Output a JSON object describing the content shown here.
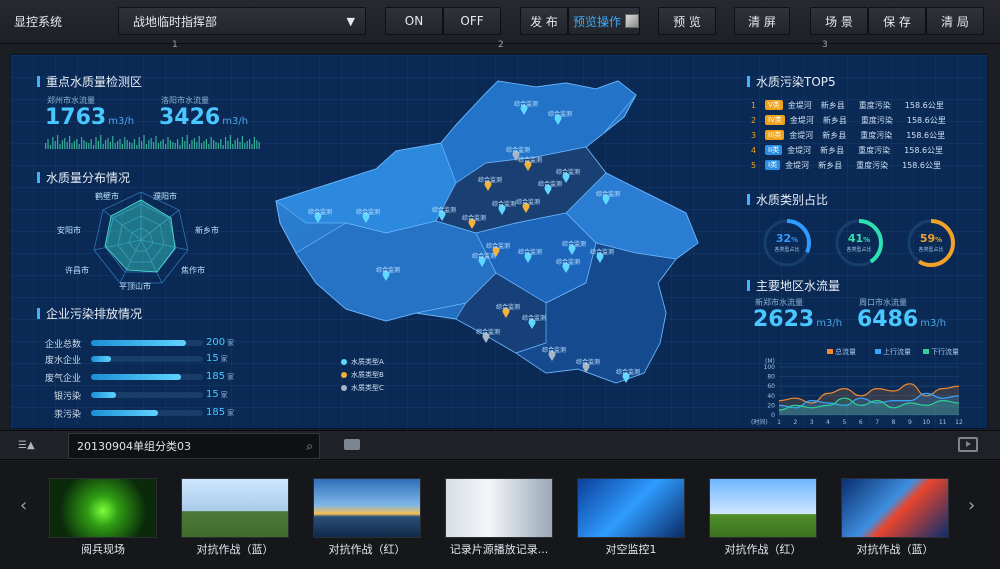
{
  "app": {
    "title": "显控系统"
  },
  "toolbar": {
    "command_select": "战地临时指挥部",
    "on_label": "ON",
    "off_label": "OFF",
    "publish_label": "发 布",
    "preview_op_label": "预览操作",
    "preview_label": "预 览",
    "clear_label": "清 屏",
    "scene_label": "场 景",
    "save_label": "保 存",
    "clear_layout_label": "清 局",
    "marker1": "1",
    "marker2": "2",
    "marker3": "3"
  },
  "left": {
    "monitor_title": "重点水质量检测区",
    "zhengzhou_label": "郑州市水流量",
    "zhengzhou_value": "1763",
    "luoyang_label": "洛阳市水流量",
    "luoyang_value": "3426",
    "flow_unit": "m3/h",
    "distribution_title": "水质量分布情况",
    "radar_labels": [
      "鹤壁市",
      "濮阳市",
      "新乡市",
      "焦作市",
      "平顶山市",
      "许昌市",
      "安阳市"
    ],
    "emission_title": "企业污染排放情况",
    "emission_unit": "家",
    "emissions": [
      {
        "label": "企业总数",
        "value": "200",
        "fraction": 0.85
      },
      {
        "label": "废水企业",
        "value": "15",
        "fraction": 0.18
      },
      {
        "label": "废气企业",
        "value": "185",
        "fraction": 0.8
      },
      {
        "label": "银污染",
        "value": "15",
        "fraction": 0.22
      },
      {
        "label": "汞污染",
        "value": "185",
        "fraction": 0.6
      }
    ]
  },
  "map": {
    "marker_label": "综合监测",
    "legend": [
      "水质类型A",
      "水质类型B",
      "水质类型C"
    ]
  },
  "right": {
    "top5_title": "水质污染TOP5",
    "top5": [
      {
        "rank": "1",
        "tag": "V类",
        "river": "金堤河",
        "county": "新乡县",
        "level": "重度污染",
        "value": "158.6公里",
        "color": "#f0a21c"
      },
      {
        "rank": "2",
        "tag": "IV类",
        "river": "金堤河",
        "county": "新乡县",
        "level": "重度污染",
        "value": "158.6公里",
        "color": "#f0a21c"
      },
      {
        "rank": "3",
        "tag": "III类",
        "river": "金堤河",
        "county": "新乡县",
        "level": "重度污染",
        "value": "158.6公里",
        "color": "#f0a21c"
      },
      {
        "rank": "4",
        "tag": "II类",
        "river": "金堤河",
        "county": "新乡县",
        "level": "重度污染",
        "value": "158.6公里",
        "color": "#2d8fe3"
      },
      {
        "rank": "5",
        "tag": "I类",
        "river": "金堤河",
        "county": "新乡县",
        "level": "重度污染",
        "value": "158.6公里",
        "color": "#2d8fe3"
      }
    ],
    "share_title": "水质类别占比",
    "shares": [
      {
        "value": "32",
        "pct": "%",
        "label": "各类型占比",
        "fraction": 0.32,
        "color": "#2f9bff"
      },
      {
        "value": "41",
        "pct": "%",
        "label": "各类型占比",
        "fraction": 0.41,
        "color": "#2fe0b0"
      },
      {
        "value": "59",
        "pct": "%",
        "label": "各类型占比",
        "fraction": 0.59,
        "color": "#f2a227"
      }
    ],
    "flow_title": "主要地区水流量",
    "region1_label": "新郑市水流量",
    "region1_value": "2623",
    "region2_label": "周口市水流量",
    "region2_value": "6486",
    "flow_unit": "m3/h"
  },
  "chart_data": {
    "type": "area",
    "ylabel": "(M)",
    "ylim": [
      0,
      100
    ],
    "yticks": [
      "100",
      "80",
      "60",
      "40",
      "20",
      "0"
    ],
    "xlabel": "(时间)",
    "x": [
      "1",
      "2",
      "3",
      "4",
      "5",
      "6",
      "7",
      "8",
      "9",
      "10",
      "11",
      "12"
    ],
    "series": [
      {
        "name": "总流量",
        "color": "#f28a2e",
        "values": [
          30,
          35,
          25,
          45,
          55,
          40,
          55,
          50,
          65,
          40,
          55,
          60
        ]
      },
      {
        "name": "上行流量",
        "color": "#38a6ff",
        "values": [
          20,
          15,
          30,
          25,
          20,
          35,
          25,
          30,
          30,
          45,
          35,
          40
        ]
      },
      {
        "name": "下行流量",
        "color": "#2fd29a",
        "values": [
          10,
          20,
          15,
          20,
          35,
          20,
          30,
          15,
          25,
          20,
          30,
          25
        ]
      }
    ]
  },
  "bottom": {
    "search_value": "20130904单组分类03"
  },
  "gallery": [
    {
      "caption": "阅兵现场"
    },
    {
      "caption": "对抗作战（蓝）"
    },
    {
      "caption": "对抗作战（红）"
    },
    {
      "caption": "记录片源播放记录..."
    },
    {
      "caption": "对空监控1"
    },
    {
      "caption": "对抗作战（红）"
    },
    {
      "caption": "对抗作战（蓝）"
    }
  ]
}
